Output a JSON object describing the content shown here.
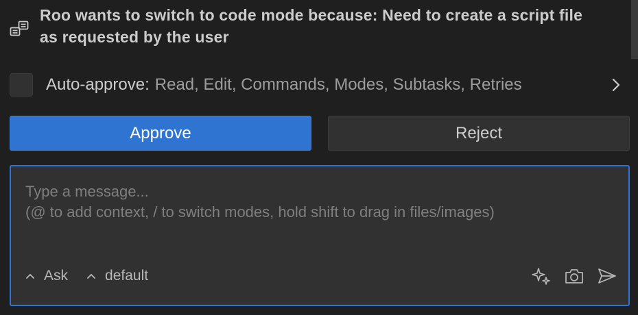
{
  "message": {
    "text": "Roo wants to switch to code mode because: Need to create a script file as requested by the user",
    "icon": "mode-switch-icon"
  },
  "auto_approve": {
    "label": "Auto-approve:",
    "items": "Read, Edit, Commands, Modes, Subtasks, Retries",
    "checked": false
  },
  "buttons": {
    "approve": "Approve",
    "reject": "Reject"
  },
  "composer": {
    "placeholder": "Type a message...\n(@ to add context, / to switch modes, hold shift to drag in files/images)",
    "mode_selector": "Ask",
    "config_selector": "default"
  },
  "colors": {
    "accent": "#2f74d0",
    "background": "#1f1f1f",
    "surface": "#313131"
  }
}
